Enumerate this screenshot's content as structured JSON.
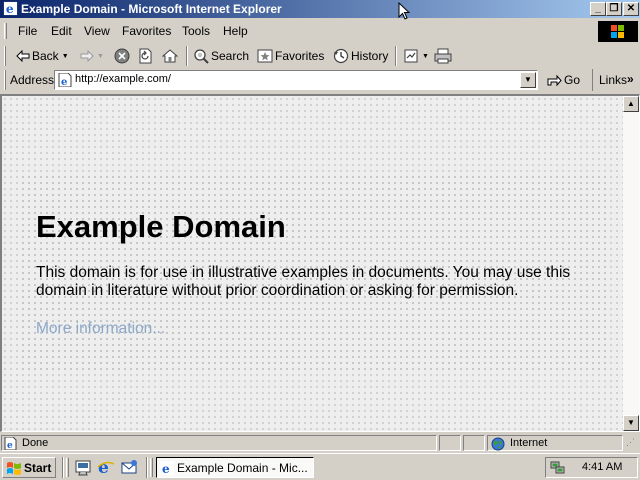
{
  "window": {
    "title": "Example Domain - Microsoft Internet Explorer",
    "minimize": "_",
    "maximize": "❐",
    "close": "✕"
  },
  "menu": [
    "File",
    "Edit",
    "View",
    "Favorites",
    "Tools",
    "Help"
  ],
  "toolbar": {
    "back": "Back",
    "search": "Search",
    "favorites": "Favorites",
    "history": "History"
  },
  "address": {
    "label": "Address",
    "url": "http://example.com/",
    "go": "Go",
    "links": "Links",
    "links_chevron": "»"
  },
  "page": {
    "heading": "Example Domain",
    "paragraph": "This domain is for use in illustrative examples in documents. You may use this domain in literature without prior coordination or asking for permission.",
    "link": "More information..."
  },
  "status": {
    "text": "Done",
    "zone": "Internet"
  },
  "taskbar": {
    "start": "Start",
    "task_label": "Example Domain - Mic...",
    "clock": "4:41 AM"
  },
  "colors": {
    "title_gradient_start": "#0a246a",
    "title_gradient_end": "#a6caf0",
    "chrome": "#d4d0c8",
    "link": "#8ca8c8"
  }
}
